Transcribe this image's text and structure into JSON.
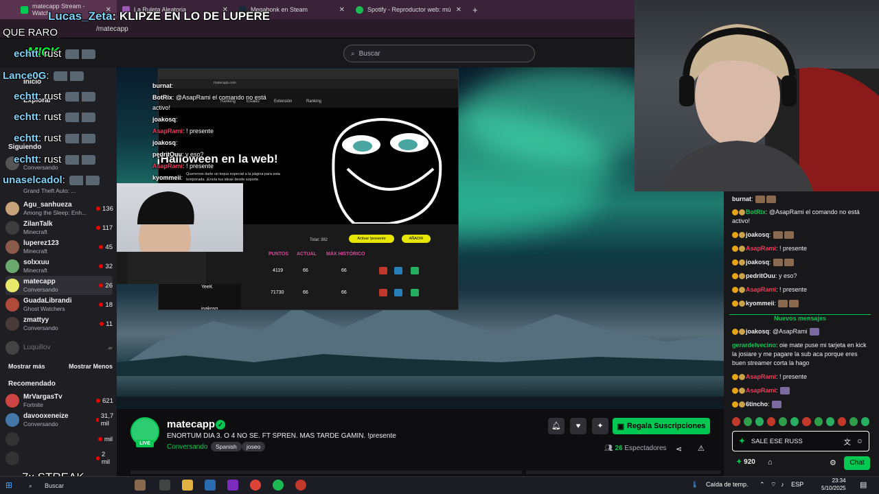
{
  "browser": {
    "tabs": [
      {
        "label": "matecapp Stream - Watch"
      },
      {
        "label": "La Ruleta Aleatoria"
      },
      {
        "label": "Megabonk en Steam"
      },
      {
        "label": "Spotify - Reproductor web: mú"
      }
    ],
    "url": "/matecapp"
  },
  "search": {
    "placeholder": "Buscar"
  },
  "overlay_chat": {
    "line1_user": "Lucas_Zeta",
    "line1_text": ": KLIPZE EN LO DE LUPERE",
    "line2_text": "QUE RARO",
    "logo": "MICK",
    "msgs": [
      {
        "user": "echtt",
        "text": ": rust"
      },
      {
        "user": "Lance0G",
        "text": ":"
      },
      {
        "user": "echtt",
        "text": ": rust"
      },
      {
        "user": "echtt",
        "text": ": rust"
      },
      {
        "user": "echtt",
        "text": ": rust"
      },
      {
        "user": "echtt",
        "text": ": rust"
      },
      {
        "user": "unaselcadol",
        "text": ":"
      }
    ],
    "streak": "7x STREAK"
  },
  "sidebar": {
    "nav": [
      "Inicio",
      "Explorar",
      "Siguiendo"
    ],
    "section_following": "Siguiendo",
    "items": [
      {
        "name": "Agu_sanhueza",
        "game": "Among the Sleep: Enh...",
        "viewers": "136",
        "color": "#c7a27a"
      },
      {
        "name": "ZilanTalk",
        "game": "Minecraft",
        "viewers": "117",
        "color": "#3d3d3d"
      },
      {
        "name": "luperez123",
        "game": "Minecraft",
        "viewers": "45",
        "color": "#8a5a4a"
      },
      {
        "name": "solxxuu",
        "game": "Minecraft",
        "viewers": "32",
        "color": "#6aa86e"
      },
      {
        "name": "matecapp",
        "game": "Conversando",
        "viewers": "26",
        "color": "#e8e86a"
      },
      {
        "name": "GuadaLibrandi",
        "game": "Ghost Watchers",
        "viewers": "18",
        "color": "#b04a3a"
      },
      {
        "name": "zmattyy",
        "game": "Conversando",
        "viewers": "11",
        "color": "#4a3a3a"
      }
    ],
    "offline": "Luquillov",
    "top_items": [
      {
        "game": "Conversando"
      },
      {
        "game": "Grand Theft Auto: ..."
      }
    ],
    "show_more": "Mostrar más",
    "show_less": "Mostrar Menos",
    "section_recommended": "Recomendado",
    "recommended": [
      {
        "name": "MrVargasTv",
        "game": "Fortnite",
        "viewers": "621",
        "color": "#c44"
      },
      {
        "name": "davooxeneize",
        "game": "Conversando",
        "viewers": "31,7 mil",
        "color": "#4477aa"
      },
      {
        "name": "",
        "game": "",
        "viewers": "mil",
        "color": "#333"
      },
      {
        "name": "",
        "game": "",
        "viewers": "2 mil",
        "color": "#333"
      }
    ]
  },
  "capture": {
    "hallo": "¡Halloween en la web!",
    "subtitle_1": "Queremos darle un toque especial a la página para esta",
    "subtitle_2": "temporada. ¡Envía tus ideas desde soporte.",
    "nav": [
      "Ranking",
      "Estado",
      "Extensión",
      "Ranking"
    ],
    "chat": [
      {
        "user": "burnat",
        "text": ":"
      },
      {
        "user": "BotRix",
        "text": ": @AsapRami el comando no está"
      },
      {
        "user": "",
        "text": "activo!"
      },
      {
        "user": "joakosq",
        "text": ":"
      },
      {
        "user": "AsapRami",
        "text": ": ! presente"
      },
      {
        "user": "joakosq",
        "text": ":"
      },
      {
        "user": "pedritOuu",
        "text": ": y eso?"
      },
      {
        "user": "AsapRami",
        "text": ": ! presente"
      },
      {
        "user": "kyommeii",
        "text": ":"
      }
    ],
    "total": "Total: 382",
    "activate_btn": "Activar !presente",
    "add_btn": "AÑADIR",
    "table_headers": [
      "PUNTOS",
      "ACTUAL",
      "MÁX HISTÓRICO"
    ],
    "rows": [
      {
        "points": "4119",
        "actual": "66",
        "max": "66"
      },
      {
        "name": "YeeK",
        "points": "71730",
        "actual": "66",
        "max": "66"
      },
      {
        "name": "joakosq"
      }
    ],
    "url": "matecapp.com"
  },
  "stream": {
    "channel": "matecapp",
    "live": "LIVE",
    "title": "ENORTUM DIA 3. O 4 NO SE.  FT SPREN. MAS TARDE GAMIN. !presente",
    "category": "Conversando",
    "tags": [
      "Spanish",
      "joseo"
    ],
    "gift_label": "Regala Suscripciones",
    "viewers_count": "26",
    "viewers_label": "Espectadores"
  },
  "chat": {
    "messages": [
      {
        "user": "burnat",
        "color": "#efeff1",
        "text": ":"
      },
      {
        "user": "BotRix",
        "color": "#00c853",
        "text": ": @AsapRami el comando no está activo!"
      },
      {
        "user": "joakosq",
        "color": "#efeff1",
        "text": ":"
      },
      {
        "user": "AsapRami",
        "color": "#eb3b5a",
        "text": ": ! presente"
      },
      {
        "user": "joakosq",
        "color": "#efeff1",
        "text": ":"
      },
      {
        "user": "pedritOuu",
        "color": "#efeff1",
        "text": ": y eso?"
      },
      {
        "user": "AsapRami",
        "color": "#eb3b5a",
        "text": ": ! presente"
      },
      {
        "user": "kyommeii",
        "color": "#efeff1",
        "text": ":"
      }
    ],
    "new_messages": "Nuevos mensajes",
    "messages2": [
      {
        "user": "joakosq",
        "color": "#efeff1",
        "text": ": @AsapRami"
      },
      {
        "user": "gerardelvecino",
        "color": "#00c853",
        "text": ": oie mate puse mi tarjeta en kick la josiare y me pagare la sub aca porque eres buen streamer corta la hago"
      },
      {
        "user": "AsapRami",
        "color": "#eb3b5a",
        "text": ": ! presente"
      },
      {
        "user": "AsapRami",
        "color": "#eb3b5a",
        "text": ":"
      },
      {
        "user": "6tincho",
        "color": "#efeff1",
        "text": ":"
      }
    ],
    "input_value": "SALE ESE RUSS",
    "points": "920",
    "send_label": "Chat"
  },
  "taskbar": {
    "search": "Buscar",
    "weather": "Caída de temp.",
    "lang": "ESP",
    "time": "23:34",
    "date": "5/10/2025"
  },
  "colors": {
    "accent": "#00c853",
    "bg": "#0e0e10",
    "panel": "#18181b",
    "sidebar": "#1f1f23"
  }
}
